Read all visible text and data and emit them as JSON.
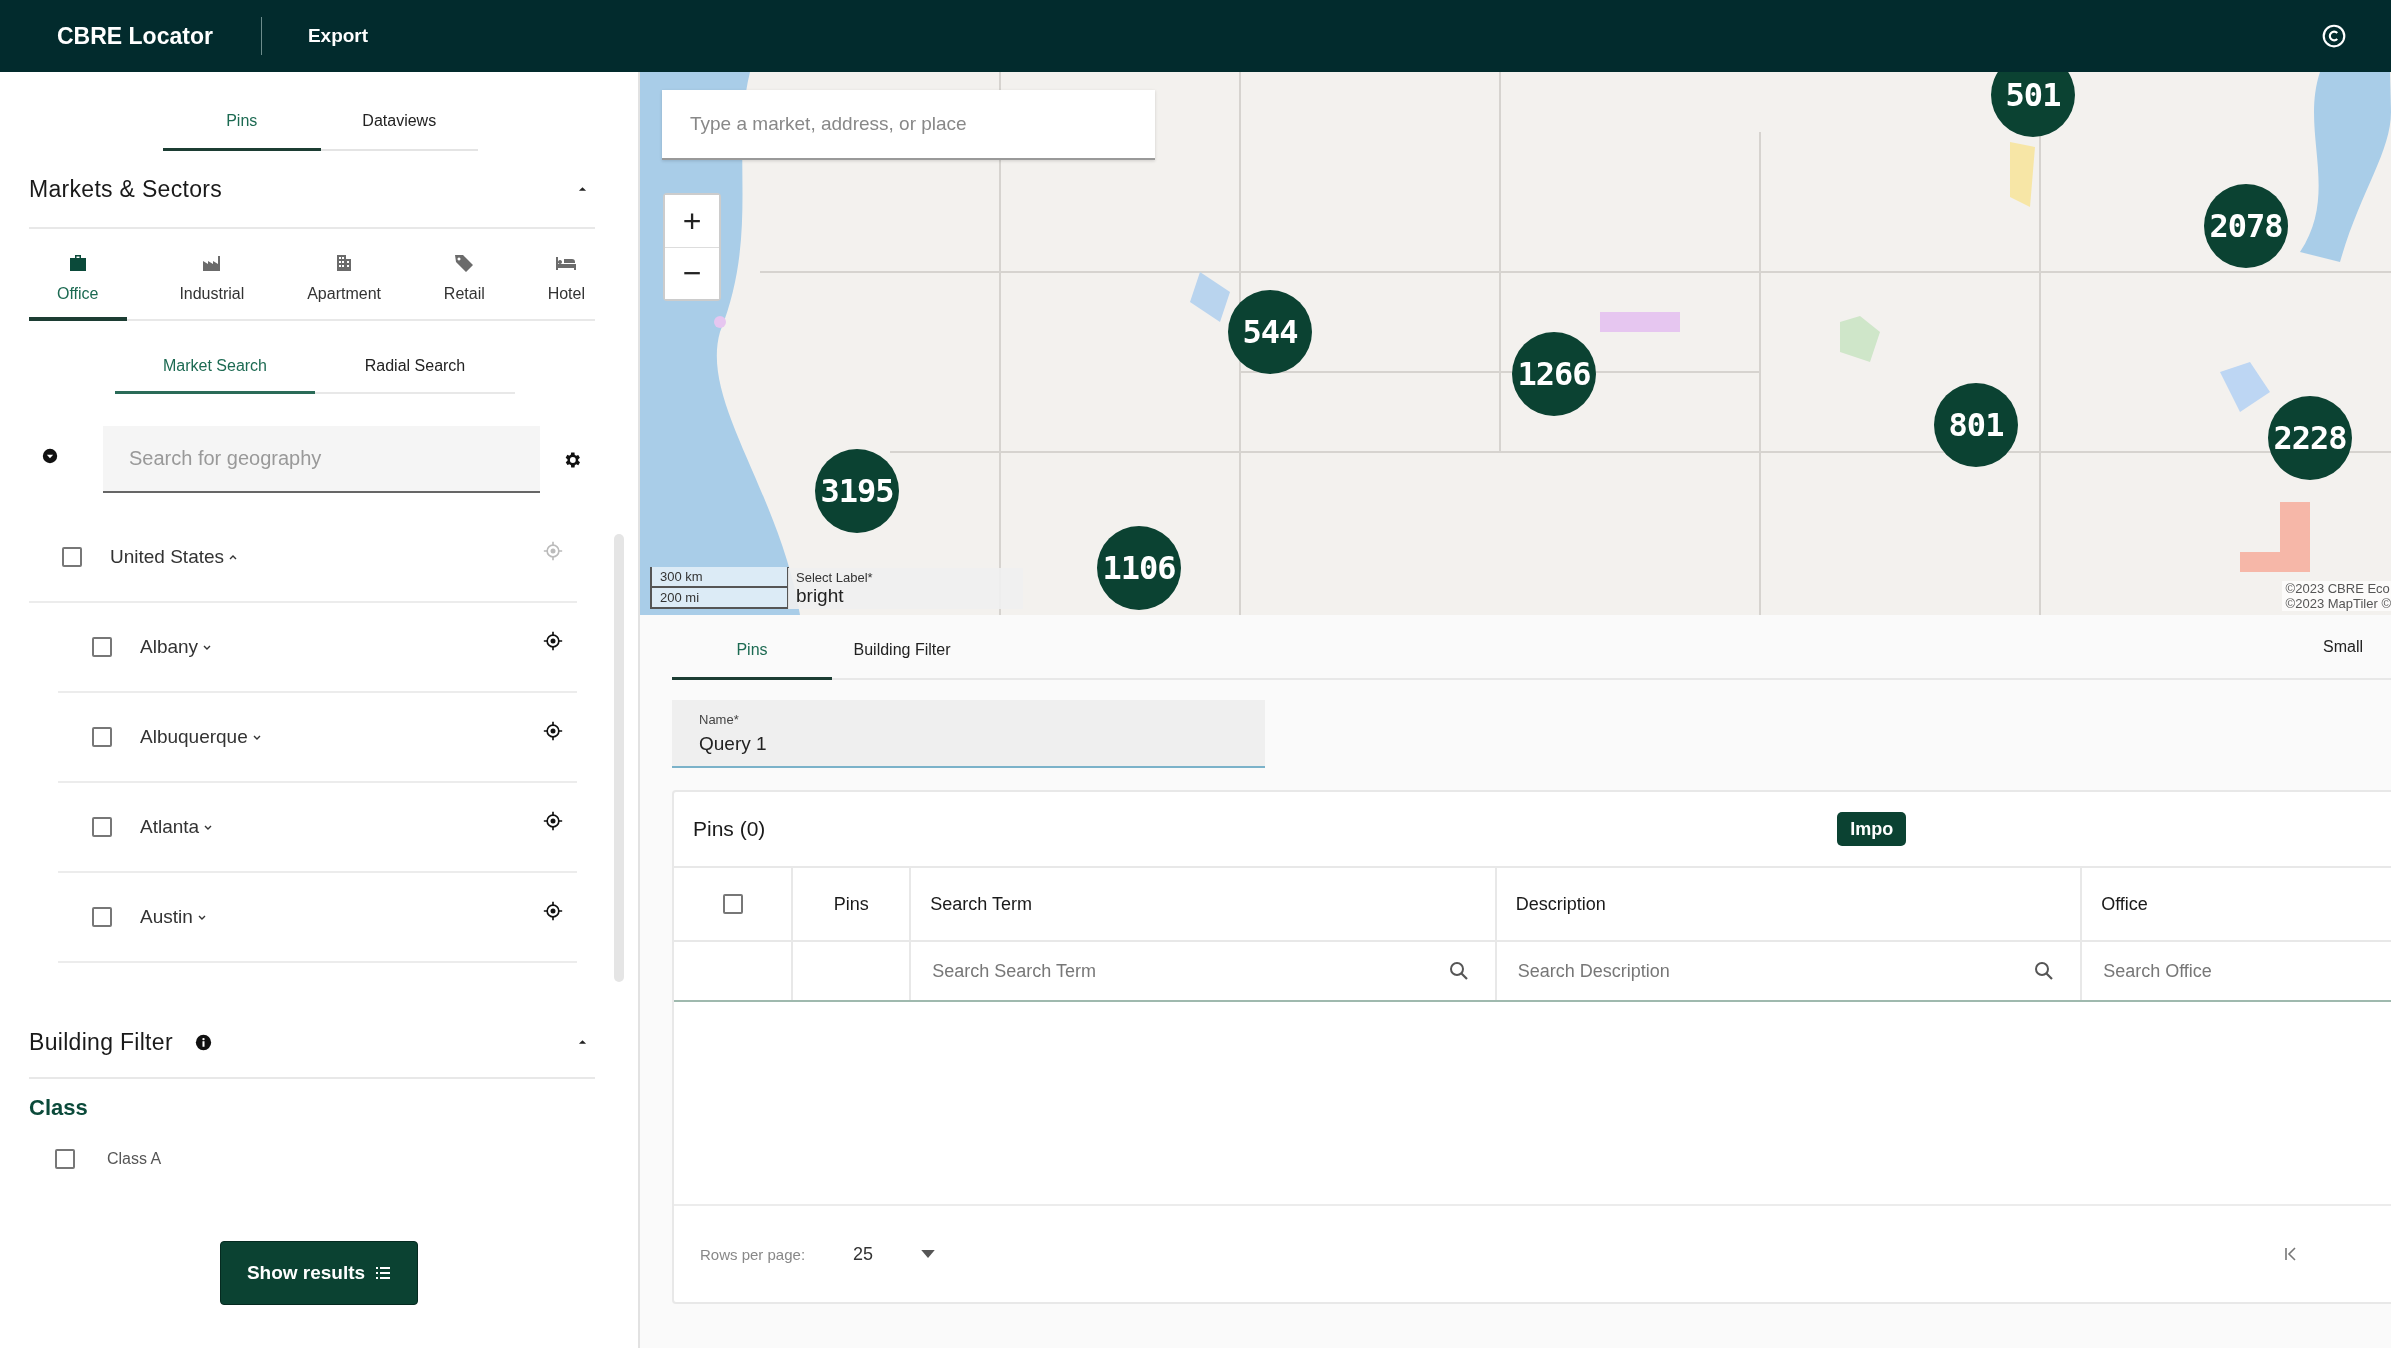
{
  "header": {
    "title": "CBRE Locator",
    "menu": [
      "Export"
    ]
  },
  "left_panel": {
    "tabs": [
      {
        "label": "Pins",
        "selected": true
      },
      {
        "label": "Dataviews",
        "selected": false
      }
    ],
    "markets_section": {
      "title": "Markets & Sectors",
      "expanded": true,
      "sectors": [
        {
          "label": "Office",
          "kind": "office",
          "selected": true
        },
        {
          "label": "Industrial",
          "kind": "industrial",
          "selected": false
        },
        {
          "label": "Apartment",
          "kind": "apartment",
          "selected": false
        },
        {
          "label": "Retail",
          "kind": "retail",
          "selected": false
        },
        {
          "label": "Hotel",
          "kind": "hotel",
          "selected": false
        }
      ],
      "search_tabs": [
        {
          "label": "Market Search",
          "selected": true
        },
        {
          "label": "Radial Search",
          "selected": false
        }
      ],
      "geo_search": {
        "placeholder": "Search for geography"
      },
      "tree": [
        {
          "label": "United States",
          "checked": false,
          "expanded": true,
          "children": [
            {
              "label": "Albany",
              "checked": false,
              "expanded": false
            },
            {
              "label": "Albuquerque",
              "checked": false,
              "expanded": false
            },
            {
              "label": "Atlanta",
              "checked": false,
              "expanded": false
            },
            {
              "label": "Austin",
              "checked": false,
              "expanded": false
            }
          ]
        }
      ]
    },
    "building_filter": {
      "title": "Building Filter",
      "expanded": true,
      "group": "Class",
      "options": [
        {
          "label": "Class A",
          "checked": false
        }
      ]
    },
    "show_results": "Show results"
  },
  "map": {
    "search_placeholder": "Type a market, address, or place",
    "zoom": [
      "+",
      "−"
    ],
    "clusters": [
      "501",
      "2078",
      "544",
      "1266",
      "801",
      "2228",
      "3195",
      "1106"
    ],
    "scale": [
      "300 km",
      "200 mi"
    ],
    "label_select": {
      "label": "Select Label*",
      "value": "bright"
    },
    "attribution": [
      "©2023 CBRE Eco",
      "©2023 MapTiler ©"
    ]
  },
  "bottom": {
    "tabs": [
      {
        "label": "Pins",
        "selected": true
      },
      {
        "label": "Building Filter",
        "selected": false
      }
    ],
    "size": "Small",
    "name_field": {
      "label": "Name*",
      "value": "Query 1"
    },
    "pins_table": {
      "title": "Pins (0)",
      "import_button": "Impo",
      "header_checked": false,
      "columns": [
        "Pins",
        "Search Term",
        "Description",
        "Office"
      ],
      "filters": [
        {
          "placeholder": "Search Search Term"
        },
        {
          "placeholder": "Search Description"
        },
        {
          "placeholder": "Search Office"
        }
      ],
      "rows_per_page_label": "Rows per page:",
      "rows_per_page": "25"
    }
  }
}
